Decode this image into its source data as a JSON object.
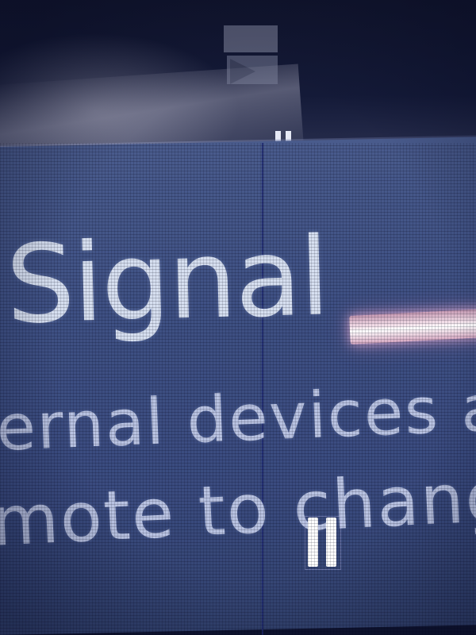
{
  "screen": {
    "title": "Signal",
    "description_lines": [
      "ernal devices an",
      "mote to change"
    ]
  },
  "icons": {
    "top_reflection": "media-reflection-icon",
    "top_indicator": "pause-icon",
    "bottom_indicator": "pause-icon"
  },
  "colors": {
    "panel": "#3e5083",
    "text": "#d6dff0",
    "focus_highlight": "#f4e0ea"
  }
}
